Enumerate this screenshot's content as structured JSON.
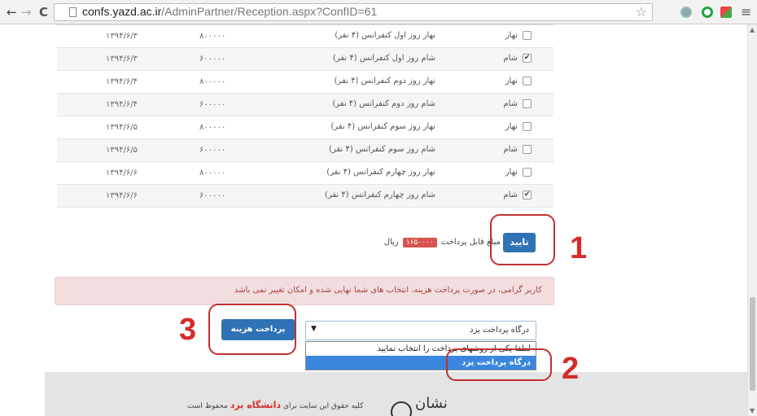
{
  "browser": {
    "url_host": "confs.yazd.ac.ir",
    "url_path": "/AdminPartner/Reception.aspx?ConfID=61"
  },
  "table": {
    "rows": [
      {
        "type": "نهار",
        "desc": "نهار روز اول کنفرانس (۴ نفر)",
        "price": "۸۰۰۰۰۰",
        "date": "۱۳۹۴/۶/۳",
        "checked": false
      },
      {
        "type": "شام",
        "desc": "شام روز اول کنفرانس (۴ نفر)",
        "price": "۶۰۰۰۰۰",
        "date": "۱۳۹۴/۶/۳",
        "checked": true
      },
      {
        "type": "نهار",
        "desc": "نهار روز دوم کنفرانس (۴ نفر)",
        "price": "۸۰۰۰۰۰",
        "date": "۱۳۹۴/۶/۴",
        "checked": false
      },
      {
        "type": "شام",
        "desc": "شام روز دوم کنفرانس (۴ نفر)",
        "price": "۶۰۰۰۰۰",
        "date": "۱۳۹۴/۶/۴",
        "checked": false
      },
      {
        "type": "نهار",
        "desc": "نهار روز سوم کنفرانس (۴ نفر)",
        "price": "۸۰۰۰۰۰",
        "date": "۱۳۹۴/۶/۵",
        "checked": false
      },
      {
        "type": "شام",
        "desc": "شام روز سوم کنفرانس (۴ نفر)",
        "price": "۶۰۰۰۰۰",
        "date": "۱۳۹۴/۶/۵",
        "checked": false
      },
      {
        "type": "نهار",
        "desc": "نهار روز چهارم کنفرانس (۴ نفر)",
        "price": "۸۰۰۰۰۰",
        "date": "۱۳۹۴/۶/۶",
        "checked": false
      },
      {
        "type": "شام",
        "desc": "شام روز چهارم کنفرانس (۴ نفر)",
        "price": "۶۰۰۰۰۰",
        "date": "۱۳۹۴/۶/۶",
        "checked": true
      }
    ]
  },
  "payment": {
    "confirm_label": "تایید",
    "amount_prefix": "مبلغ قابل پرداخت",
    "amount_value": "۱۶۵۰۰۰۰",
    "amount_unit": "ریال"
  },
  "alert": {
    "text": "کاربر گرامی، در صورت پرداخت هزینه، انتخاب های شما نهایی شده و امکان تغییر نمی باشد"
  },
  "gateway": {
    "pay_button_label": "پرداخت هزینه",
    "selected_value": "درگاه پرداخت یزد",
    "options": [
      "لطفا یکی از روشهای پرداخت را انتخاب نمایید",
      "درگاه پرداخت یزد"
    ],
    "highlighted_index": 1
  },
  "annotations": {
    "step1": "1",
    "step2": "2",
    "step3": "3"
  },
  "footer": {
    "copyright_prefix": "کلیه حقوق این سایت برای",
    "copyright_owner": "دانشگاه یزد",
    "copyright_suffix": "محفوظ است",
    "logo_text": "نشان"
  },
  "colors": {
    "accent": "#2f72b5",
    "annotation": "#d42b2b",
    "alert_bg": "#f2dede",
    "badge": "#d9534f"
  }
}
